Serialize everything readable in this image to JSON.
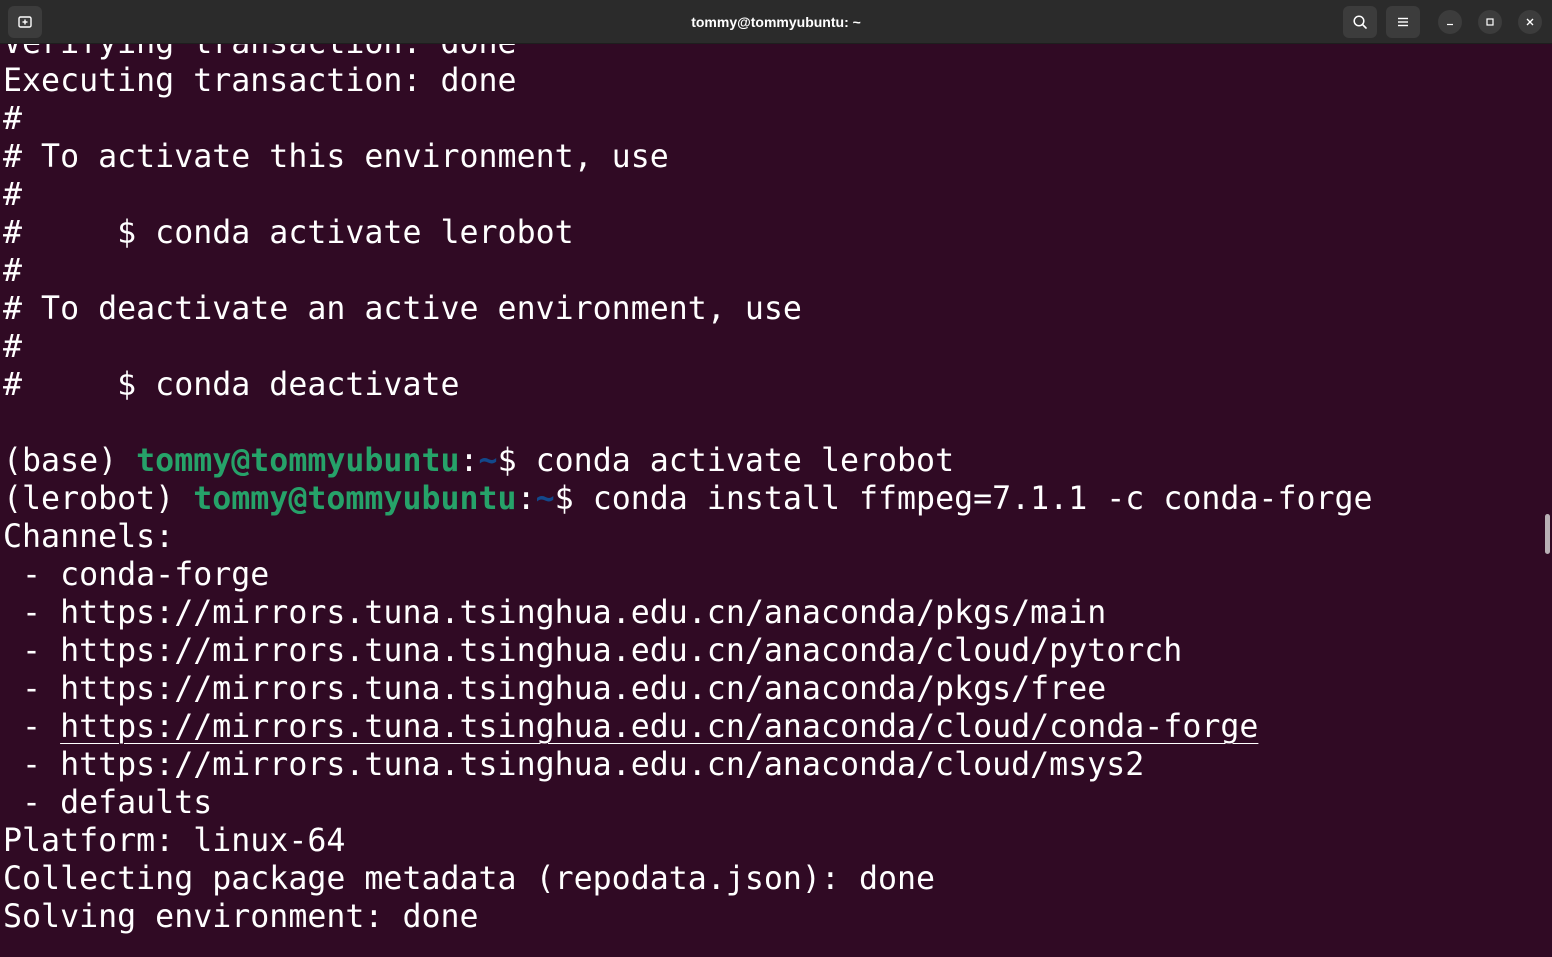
{
  "window": {
    "title": "tommy@tommyubuntu: ~"
  },
  "icons": {
    "new_tab": "new-tab-icon",
    "search": "search-icon",
    "menu": "hamburger-menu-icon",
    "minimize": "minimize-icon",
    "maximize": "maximize-icon",
    "close": "close-icon"
  },
  "colors": {
    "terminal_bg": "#300a24",
    "titlebar_bg": "#2b2b2b",
    "prompt_user": "#26a269",
    "prompt_path": "#12488b",
    "text": "#ffffff"
  },
  "terminal": {
    "lines": [
      "Verifying transaction: done",
      "Executing transaction: done",
      "#",
      "# To activate this environment, use",
      "#",
      "#     $ conda activate lerobot",
      "#",
      "# To deactivate an active environment, use",
      "#",
      "#     $ conda deactivate",
      ""
    ],
    "prompt1": {
      "env": "(base) ",
      "user": "tommy@tommyubuntu",
      "colon": ":",
      "path": "~",
      "dollar": "$ ",
      "command": "conda activate lerobot"
    },
    "prompt2": {
      "env": "(lerobot) ",
      "user": "tommy@tommyubuntu",
      "colon": ":",
      "path": "~",
      "dollar": "$ ",
      "command": "conda install ffmpeg=7.1.1 -c conda-forge"
    },
    "output": {
      "channels_header": "Channels:",
      "channel_bullet": " - ",
      "channels": [
        "conda-forge",
        "https://mirrors.tuna.tsinghua.edu.cn/anaconda/pkgs/main",
        "https://mirrors.tuna.tsinghua.edu.cn/anaconda/cloud/pytorch",
        "https://mirrors.tuna.tsinghua.edu.cn/anaconda/pkgs/free",
        "https://mirrors.tuna.tsinghua.edu.cn/anaconda/cloud/conda-forge",
        "https://mirrors.tuna.tsinghua.edu.cn/anaconda/cloud/msys2",
        "defaults"
      ],
      "platform": "Platform: linux-64",
      "collecting": "Collecting package metadata (repodata.json): done",
      "solving": "Solving environment: done"
    }
  }
}
